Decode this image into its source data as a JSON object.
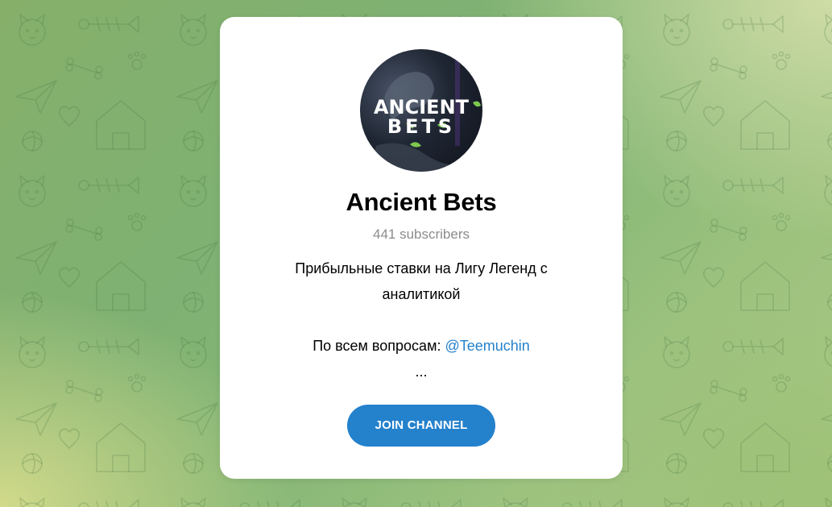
{
  "channel": {
    "name": "Ancient Bets",
    "subscribers": "441 subscribers",
    "avatar_text_line1": "ANCIENT",
    "avatar_text_line2": "BETS",
    "description_line1": "Прибыльные ставки на Лигу Легенд с",
    "description_line2": "аналитикой",
    "contact_prefix": "По всем вопросам: ",
    "contact_handle": "@Teemuchin",
    "ellipsis": "..."
  },
  "actions": {
    "join_label": "JOIN CHANNEL"
  },
  "colors": {
    "accent": "#2481cc",
    "muted_text": "#8c8c8c",
    "card_bg": "#ffffff"
  }
}
